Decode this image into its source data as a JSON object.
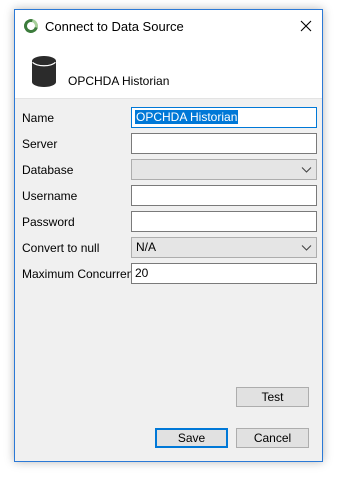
{
  "window": {
    "title": "Connect to Data Source"
  },
  "header": {
    "title": "OPCHDA Historian"
  },
  "form": {
    "name": {
      "label": "Name",
      "value": "OPCHDA Historian"
    },
    "server": {
      "label": "Server",
      "value": ""
    },
    "database": {
      "label": "Database",
      "value": ""
    },
    "username": {
      "label": "Username",
      "value": ""
    },
    "password": {
      "label": "Password",
      "value": ""
    },
    "convert_to_null": {
      "label": "Convert to null",
      "value": "N/A"
    },
    "max_concurrent": {
      "label": "Maximum Concurrent",
      "value": "20"
    }
  },
  "buttons": {
    "test": "Test",
    "save": "Save",
    "cancel": "Cancel"
  },
  "icons": {
    "app": "connection-spinner-icon",
    "close": "close-icon",
    "database": "database-icon",
    "dropdown": "chevron-down-icon"
  }
}
